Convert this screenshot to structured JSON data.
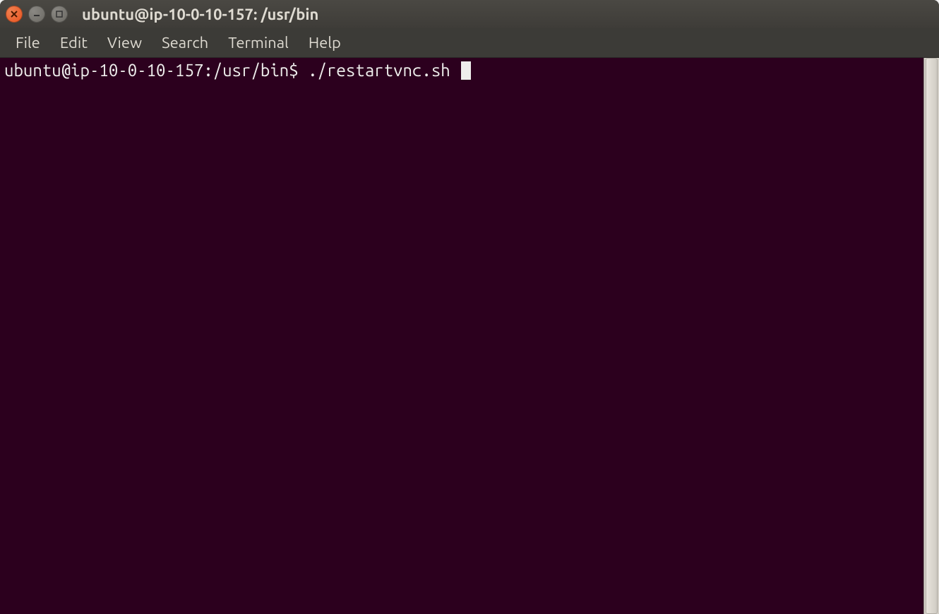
{
  "window": {
    "title": "ubuntu@ip-10-0-10-157: /usr/bin"
  },
  "menu": {
    "items": [
      "File",
      "Edit",
      "View",
      "Search",
      "Terminal",
      "Help"
    ]
  },
  "terminal": {
    "prompt": "ubuntu@ip-10-0-10-157:/usr/bin$ ",
    "command": "./restartvnc.sh "
  }
}
